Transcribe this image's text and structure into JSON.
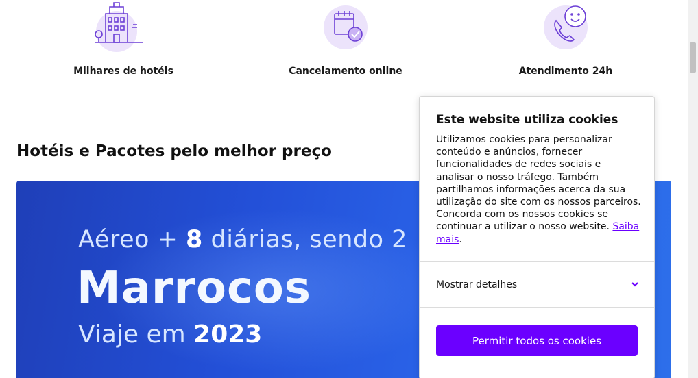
{
  "features": [
    {
      "label": "Milhares de hotéis",
      "icon": "hotel-building-icon"
    },
    {
      "label": "Cancelamento online",
      "icon": "calendar-check-icon"
    },
    {
      "label": "Atendimento 24h",
      "icon": "phone-chat-icon"
    }
  ],
  "section": {
    "title": "Hotéis e Pacotes pelo melhor preço"
  },
  "banner": {
    "line1_prefix": "Aéreo + ",
    "line1_bold": "8",
    "line1_suffix": " diárias, sendo 2",
    "destination": "Marrocos",
    "line3_prefix": "Viaje em ",
    "line3_year": "2023"
  },
  "cookie": {
    "title": "Este website utiliza cookies",
    "text": "Utilizamos cookies para personalizar conteúdo e anúncios, fornecer funcionalidades de redes sociais e analisar o nosso tráfego. Também partilhamos informações acerca da sua utilização do site com os nossos parceiros. Concorda com os nossos cookies se continuar a utilizar o nosso website.",
    "link": "Saiba mais",
    "link_end": ".",
    "details": "Mostrar detalhes",
    "allow_button": "Permitir todos os cookies"
  },
  "colors": {
    "accent": "#6b00ff",
    "icon_bg": "#ece3fb",
    "icon_stroke": "#6c3fd6",
    "banner_blue": "#2350d8"
  }
}
